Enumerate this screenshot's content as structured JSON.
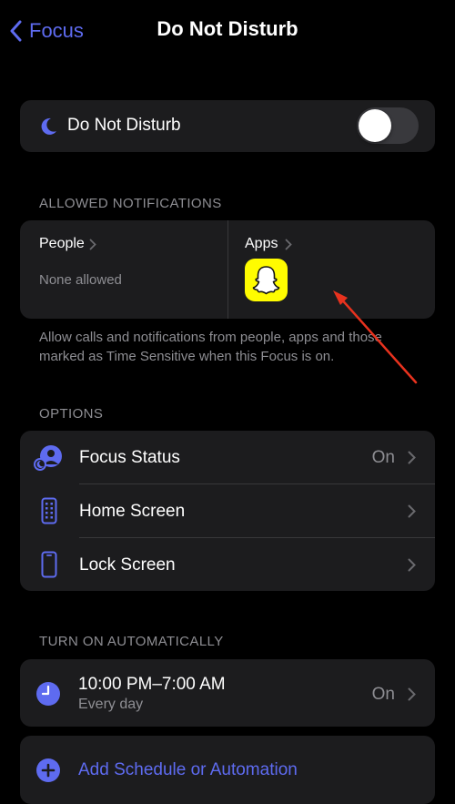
{
  "nav": {
    "back_label": "Focus",
    "title": "Do Not Disturb"
  },
  "main_toggle": {
    "label": "Do Not Disturb",
    "state": "off"
  },
  "allowed": {
    "header": "ALLOWED NOTIFICATIONS",
    "people_label": "People",
    "people_value": "None allowed",
    "apps_label": "Apps",
    "apps": [
      "Snapchat"
    ],
    "footnote": "Allow calls and notifications from people, apps and those marked as Time Sensitive when this Focus is on."
  },
  "options": {
    "header": "OPTIONS",
    "items": [
      {
        "label": "Focus Status",
        "value": "On",
        "icon": "focus-status-icon"
      },
      {
        "label": "Home Screen",
        "value": "",
        "icon": "home-screen-icon"
      },
      {
        "label": "Lock Screen",
        "value": "",
        "icon": "lock-screen-icon"
      }
    ]
  },
  "automatic": {
    "header": "TURN ON AUTOMATICALLY",
    "schedule_time": "10:00 PM–7:00 AM",
    "schedule_days": "Every day",
    "schedule_value": "On",
    "add_label": "Add Schedule or Automation"
  },
  "colors": {
    "accent": "#5e6bf0",
    "card": "#1c1c1e",
    "background": "#000000",
    "snapchat": "#fffc00",
    "annotation_arrow": "#e8321e"
  }
}
